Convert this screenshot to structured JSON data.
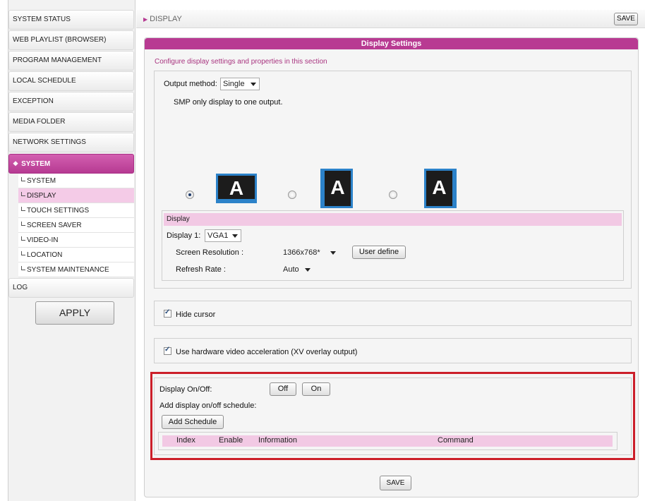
{
  "sidebar": {
    "items": [
      {
        "label": "SYSTEM STATUS"
      },
      {
        "label": "WEB PLAYLIST (BROWSER)"
      },
      {
        "label": "PROGRAM MANAGEMENT"
      },
      {
        "label": "LOCAL SCHEDULE"
      },
      {
        "label": "EXCEPTION"
      },
      {
        "label": "MEDIA FOLDER"
      },
      {
        "label": "NETWORK SETTINGS"
      },
      {
        "label": "SYSTEM",
        "active": true
      }
    ],
    "sub_items": [
      {
        "label": "SYSTEM"
      },
      {
        "label": "DISPLAY",
        "active": true
      },
      {
        "label": "TOUCH SETTINGS"
      },
      {
        "label": "SCREEN SAVER"
      },
      {
        "label": "VIDEO-IN"
      },
      {
        "label": "LOCATION"
      },
      {
        "label": "SYSTEM MAINTENANCE"
      }
    ],
    "log_label": "LOG",
    "apply_label": "APPLY"
  },
  "header": {
    "breadcrumb": "DISPLAY",
    "save_label": "SAVE"
  },
  "panel": {
    "title": "Display Settings",
    "description": "Configure display settings and properties in this section",
    "output_method_label": "Output method:",
    "output_method_value": "Single",
    "output_note": "SMP only display to one output.",
    "monitor_glyph": "A",
    "display_section": {
      "title": "Display",
      "display1_label": "Display 1:",
      "display1_value": "VGA1",
      "resolution_label": "Screen Resolution :",
      "resolution_value": "1366x768*",
      "user_define_label": "User define",
      "refresh_label": "Refresh Rate :",
      "refresh_value": "Auto"
    },
    "hide_cursor_label": "Hide cursor",
    "hw_accel_label": "Use hardware video acceleration (XV overlay output)",
    "display_onoff": {
      "label": "Display On/Off:",
      "off_label": "Off",
      "on_label": "On",
      "schedule_label": "Add display on/off schedule:",
      "add_schedule_label": "Add Schedule",
      "table_headers": [
        "Index",
        "Enable",
        "Information",
        "Command"
      ]
    },
    "save_label": "SAVE"
  },
  "colors": {
    "accent": "#b83a92",
    "section_bg": "#f2c9e4",
    "highlight": "#cc1f2a",
    "monitor_frame": "#2c82c9"
  }
}
